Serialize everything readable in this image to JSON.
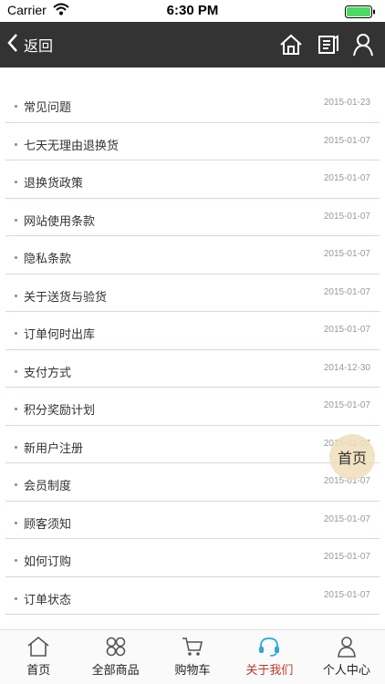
{
  "status_bar": {
    "carrier": "Carrier",
    "time": "6:30 PM"
  },
  "nav": {
    "back_label": "返回"
  },
  "list": [
    {
      "title": "常见问题",
      "date": "2015-01-23"
    },
    {
      "title": "七天无理由退换货",
      "date": "2015-01-07"
    },
    {
      "title": "退换货政策",
      "date": "2015-01-07"
    },
    {
      "title": "网站使用条款",
      "date": "2015-01-07"
    },
    {
      "title": "隐私条款",
      "date": "2015-01-07"
    },
    {
      "title": "关于送货与验货",
      "date": "2015-01-07"
    },
    {
      "title": "订单何时出库",
      "date": "2015-01-07"
    },
    {
      "title": "支付方式",
      "date": "2014-12-30"
    },
    {
      "title": "积分奖励计划",
      "date": "2015-01-07"
    },
    {
      "title": "新用户注册",
      "date": "2015-01-07"
    },
    {
      "title": "会员制度",
      "date": "2015-01-07"
    },
    {
      "title": "顾客须知",
      "date": "2015-01-07"
    },
    {
      "title": "如何订购",
      "date": "2015-01-07"
    },
    {
      "title": "订单状态",
      "date": "2015-01-07"
    }
  ],
  "float_button": {
    "label": "首页"
  },
  "tabs": [
    {
      "label": "首页",
      "icon": "home-icon"
    },
    {
      "label": "全部商品",
      "icon": "grid-icon"
    },
    {
      "label": "购物车",
      "icon": "cart-icon"
    },
    {
      "label": "关于我们",
      "icon": "headset-icon",
      "active": true
    },
    {
      "label": "个人中心",
      "icon": "user-icon"
    }
  ],
  "colors": {
    "nav_bg": "#333333",
    "active_tab": "#c0392b",
    "divider": "#e0d9c8",
    "float_bg": "#eedeb8"
  }
}
